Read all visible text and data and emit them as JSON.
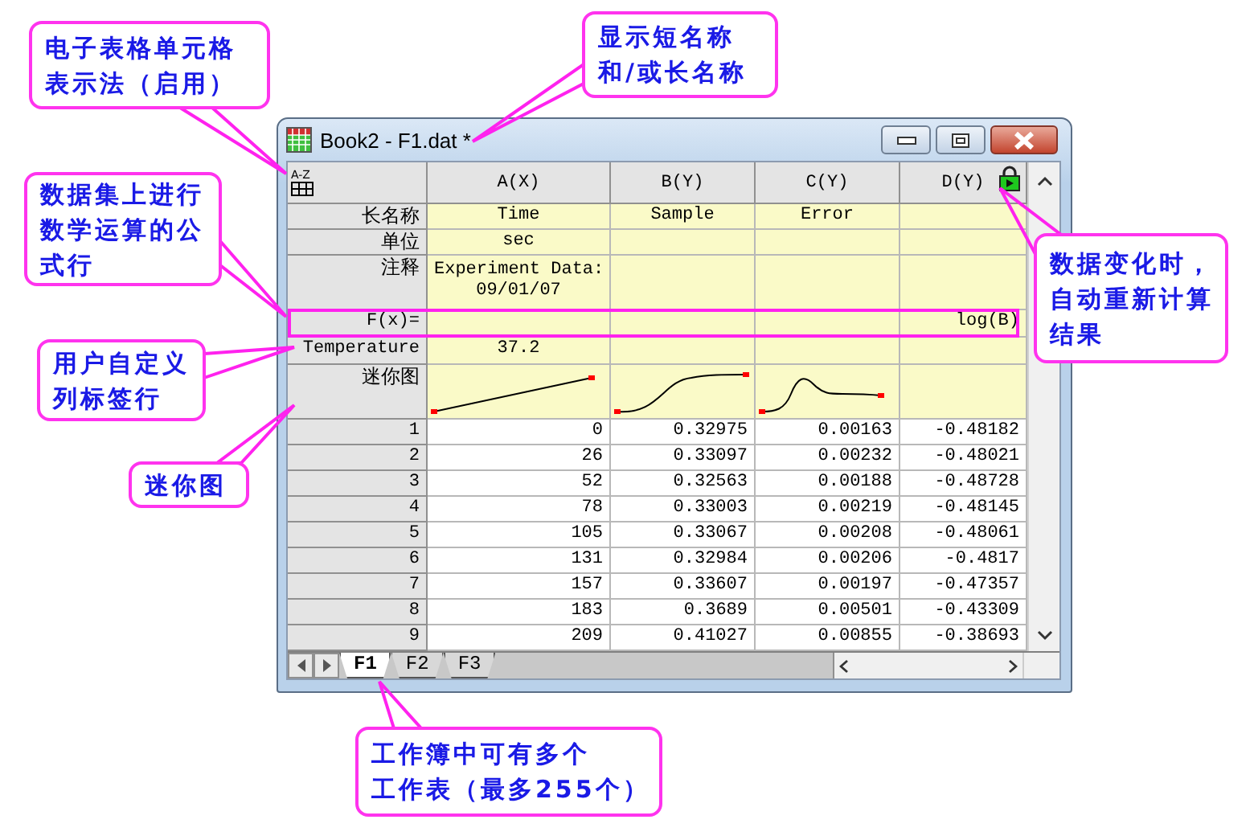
{
  "window": {
    "title": "Book2 - F1.dat *"
  },
  "worksheet": {
    "corner_label": "A-Z",
    "label_rows": [
      "长名称",
      "单位",
      "注释",
      "F(x)=",
      "Temperature",
      "迷你图"
    ],
    "columns": [
      {
        "name": "A(X)",
        "long_name": "Time",
        "units": "sec",
        "comments": "Experiment Data:\n09/01/07",
        "user_param": "37.2",
        "sparkline": true
      },
      {
        "name": "B(Y)",
        "long_name": "Sample",
        "sparkline": true
      },
      {
        "name": "C(Y)",
        "long_name": "Error",
        "sparkline": true
      },
      {
        "name": "D(Y)",
        "formula": "log(B)",
        "recalc_locked": true
      }
    ],
    "rows": [
      {
        "index": "1",
        "cells": [
          "0",
          "0.32975",
          "0.00163",
          "-0.48182"
        ]
      },
      {
        "index": "2",
        "cells": [
          "26",
          "0.33097",
          "0.00232",
          "-0.48021"
        ]
      },
      {
        "index": "3",
        "cells": [
          "52",
          "0.32563",
          "0.00188",
          "-0.48728"
        ]
      },
      {
        "index": "4",
        "cells": [
          "78",
          "0.33003",
          "0.00219",
          "-0.48145"
        ]
      },
      {
        "index": "5",
        "cells": [
          "105",
          "0.33067",
          "0.00208",
          "-0.48061"
        ]
      },
      {
        "index": "6",
        "cells": [
          "131",
          "0.32984",
          "0.00206",
          "-0.4817"
        ]
      },
      {
        "index": "7",
        "cells": [
          "157",
          "0.33607",
          "0.00197",
          "-0.47357"
        ]
      },
      {
        "index": "8",
        "cells": [
          "183",
          "0.3689",
          "0.00501",
          "-0.43309"
        ]
      },
      {
        "index": "9",
        "cells": [
          "209",
          "0.41027",
          "0.00855",
          "-0.38693"
        ]
      }
    ],
    "sheet_tabs": [
      {
        "label": "F1",
        "selected": true
      },
      {
        "label": "F2",
        "selected": false
      },
      {
        "label": "F3",
        "selected": false
      }
    ]
  },
  "callouts": [
    {
      "text": "电子表格单元格表示法（启用）"
    },
    {
      "text": "显示短名称和/或长名称"
    },
    {
      "text": "数据集上进行数学运算的公式行"
    },
    {
      "text": "用户自定义列标签行"
    },
    {
      "text": "迷你图"
    },
    {
      "text": "数据变化时，自动重新计算结果"
    },
    {
      "text": "工作簿中可有多个工作表（最多255个）"
    }
  ]
}
